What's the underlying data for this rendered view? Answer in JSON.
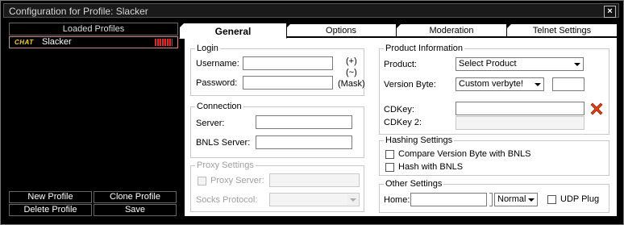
{
  "window": {
    "title": "Configuration for Profile: Slacker",
    "close_glyph": "×"
  },
  "left_panel": {
    "header": "Loaded Profiles",
    "profiles": [
      {
        "badge": "CHAT",
        "name": "Slacker"
      }
    ],
    "buttons": {
      "new_profile": "New Profile",
      "clone_profile": "Clone Profile",
      "delete_profile": "Delete Profile",
      "save": "Save"
    }
  },
  "tabs": [
    "General",
    "Options",
    "Moderation",
    "Telnet Settings"
  ],
  "general": {
    "login": {
      "legend": "Login",
      "username_label": "Username:",
      "password_label": "Password:",
      "username_value": "",
      "password_value": "",
      "hint_plus": "(+)",
      "hint_tilde": "(~)",
      "hint_mask": "(Mask)"
    },
    "connection": {
      "legend": "Connection",
      "server_label": "Server:",
      "bnls_label": "BNLS Server:",
      "server_value": "",
      "bnls_value": ""
    },
    "proxy": {
      "legend": "Proxy Settings",
      "proxy_server_label": "Proxy Server:",
      "socks_label": "Socks Protocol:",
      "proxy_value": "",
      "socks_value": ""
    },
    "product": {
      "legend": "Product Information",
      "product_label": "Product:",
      "product_value": "Select Product",
      "version_label": "Version Byte:",
      "version_value": "Custom verbyte!",
      "version_custom": "",
      "cdkey_label": "CDKey:",
      "cdkey2_label": "CDKey 2:",
      "cdkey_value": "",
      "cdkey2_value": ""
    },
    "hashing": {
      "legend": "Hashing Settings",
      "compare_label": "Compare Version Byte with BNLS",
      "hash_label": "Hash with BNLS"
    },
    "other": {
      "legend": "Other Settings",
      "home_label": "Home:",
      "home_value": "",
      "home_channel": "",
      "priority": "Normal",
      "udp_label": "UDP Plug"
    }
  },
  "colors": {
    "accent_clear": "#e04010",
    "signal": "#e22222",
    "chat_badge": "#f5d800"
  }
}
